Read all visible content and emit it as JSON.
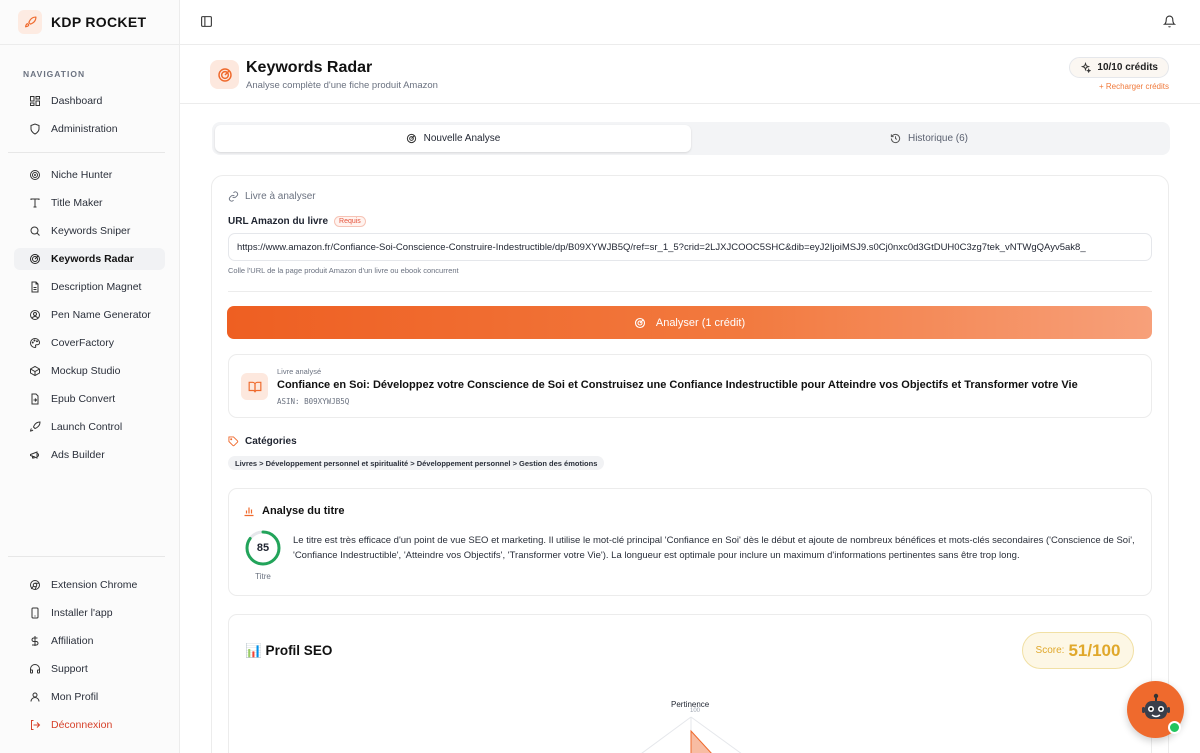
{
  "brand": {
    "name": "KDP ROCKET"
  },
  "sidebar": {
    "heading": "NAVIGATION",
    "top_items": [
      {
        "label": "Dashboard",
        "icon": "grid-icon"
      },
      {
        "label": "Administration",
        "icon": "shield-icon"
      }
    ],
    "tool_items": [
      {
        "label": "Niche Hunter",
        "icon": "target-icon"
      },
      {
        "label": "Title Maker",
        "icon": "type-icon"
      },
      {
        "label": "Keywords Sniper",
        "icon": "search-icon"
      },
      {
        "label": "Keywords Radar",
        "icon": "radar-icon",
        "active": true
      },
      {
        "label": "Description Magnet",
        "icon": "file-text-icon"
      },
      {
        "label": "Pen Name Generator",
        "icon": "user-circle-icon"
      },
      {
        "label": "CoverFactory",
        "icon": "palette-icon"
      },
      {
        "label": "Mockup Studio",
        "icon": "box-icon"
      },
      {
        "label": "Epub Convert",
        "icon": "file-convert-icon"
      },
      {
        "label": "Launch Control",
        "icon": "rocket-icon"
      },
      {
        "label": "Ads Builder",
        "icon": "megaphone-icon"
      }
    ],
    "bottom_items": [
      {
        "label": "Extension Chrome",
        "icon": "chrome-icon"
      },
      {
        "label": "Installer l'app",
        "icon": "phone-icon"
      },
      {
        "label": "Affiliation",
        "icon": "dollar-icon"
      },
      {
        "label": "Support",
        "icon": "headset-icon"
      },
      {
        "label": "Mon Profil",
        "icon": "user-icon"
      },
      {
        "label": "Déconnexion",
        "icon": "logout-icon"
      }
    ]
  },
  "header": {
    "title": "Keywords Radar",
    "subtitle": "Analyse complète d'une fiche produit Amazon",
    "credits": "10/10 crédits",
    "recharge": "+ Recharger crédits"
  },
  "tabs": [
    {
      "label": "Nouvelle Analyse",
      "active": true
    },
    {
      "label": "Historique (6)",
      "active": false
    }
  ],
  "form": {
    "section_label": "Livre à analyser",
    "url_label": "URL Amazon du livre",
    "required_badge": "Requis",
    "url_value": "https://www.amazon.fr/Confiance-Soi-Conscience-Construire-Indestructible/dp/B09XYWJB5Q/ref=sr_1_5?crid=2LJXJCOOC5SHC&dib=eyJ2IjoiMSJ9.s0Cj0nxc0d3GtDUH0C3zg7tek_vNTWgQAyv5ak8_",
    "hint": "Colle l'URL de la page produit Amazon d'un livre ou ebook concurrent",
    "analyze_button": "Analyser (1 crédit)"
  },
  "book": {
    "small_label": "Livre analysé",
    "title": "Confiance en Soi: Développez votre Conscience de Soi et Construisez une Confiance Indestructible pour Atteindre vos Objectifs et Transformer votre Vie",
    "asin": "ASIN: B09XYWJB5Q"
  },
  "categories": {
    "title": "Catégories",
    "path": "Livres > Développement personnel et spiritualité > Développement personnel > Gestion des émotions"
  },
  "title_analysis": {
    "heading": "Analyse du titre",
    "score": 85,
    "score_label": "Titre",
    "text": "Le titre est très efficace d'un point de vue SEO et marketing. Il utilise le mot-clé principal 'Confiance en Soi' dès le début et ajoute de nombreux bénéfices et mots-clés secondaires ('Conscience de Soi', 'Confiance Indestructible', 'Atteindre vos Objectifs', 'Transformer votre Vie'). La longueur est optimale pour inclure un maximum d'informations pertinentes sans être trop long."
  },
  "seo_profile": {
    "heading": "📊 Profil SEO",
    "score_label": "Score:",
    "score_value": "51/100",
    "radar_axis": "Pertinence",
    "radar_tick": "100"
  },
  "colors": {
    "accent": "#ef6a2d",
    "gauge": "#22a45a",
    "score": "#e0a82b",
    "logout": "#d6412a"
  }
}
